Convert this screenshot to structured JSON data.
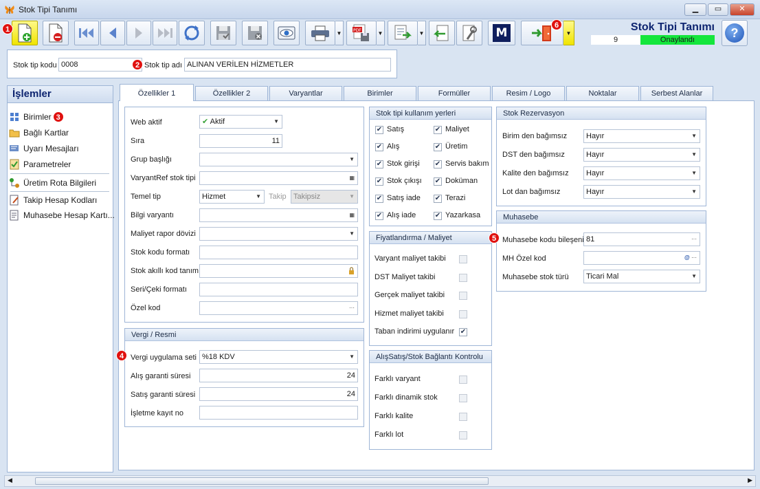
{
  "window": {
    "title": "Stok Tipi Tanımı",
    "min": "▁",
    "max": "▭",
    "close": "✕"
  },
  "header": {
    "title": "Stok Tipi Tanımı",
    "number": "9",
    "status": "Onaylandı",
    "status_color": "#14e63c"
  },
  "badges": [
    "1",
    "2",
    "3",
    "4",
    "5",
    "6"
  ],
  "toolbar": {
    "m_label": "M",
    "help_label": "?",
    "pdf_label": "PDF"
  },
  "top": {
    "code_label": "Stok tip kodu",
    "code_value": "0008",
    "name_label": "Stok tip adı",
    "name_value": "ALINAN VERİLEN HİZMETLER"
  },
  "sidebar": {
    "title": "İşlemler",
    "items": [
      "Birimler",
      "Bağlı Kartlar",
      "Uyarı Mesajları",
      "Parametreler",
      "Üretim Rota Bilgileri",
      "Takip Hesap Kodları",
      "Muhasebe Hesap Kartı..."
    ]
  },
  "tabs": [
    "Özellikler 1",
    "Özellikler 2",
    "Varyantlar",
    "Birimler",
    "Formüller",
    "Resim / Logo",
    "Noktalar",
    "Serbest Alanlar"
  ],
  "props": {
    "web_aktif": {
      "label": "Web aktif",
      "value": "Aktif"
    },
    "sira": {
      "label": "Sıra",
      "value": "11"
    },
    "grup": {
      "label": "Grup başlığı",
      "value": ""
    },
    "varyantref": {
      "label": "VaryantRef stok tipi",
      "value": ""
    },
    "temel_tip": {
      "label": "Temel tip",
      "value": "Hizmet",
      "takip_label": "Takip",
      "takip_value": "Takipsiz"
    },
    "bilgi_varyanti": {
      "label": "Bilgi varyantı",
      "value": ""
    },
    "maliyet_rapor": {
      "label": "Maliyet rapor dövizi",
      "value": ""
    },
    "stok_kodu_formati": {
      "label": "Stok kodu formatı",
      "value": ""
    },
    "akilli_kod": {
      "label": "Stok akıllı kod tanımı",
      "value": ""
    },
    "seri_ceki": {
      "label": "Seri/Çeki formatı",
      "value": ""
    },
    "ozel_kod": {
      "label": "Özel kod",
      "value": ""
    }
  },
  "vergi": {
    "title": "Vergi / Resmi",
    "uygulama": {
      "label": "Vergi uygulama seti",
      "value": "%18 KDV"
    },
    "alis_garanti": {
      "label": "Alış garanti süresi",
      "value": "24"
    },
    "satis_garanti": {
      "label": "Satış garanti süresi",
      "value": "24"
    },
    "isletme": {
      "label": "İşletme kayıt no",
      "value": ""
    }
  },
  "kullanim": {
    "title": "Stok tipi kullanım yerleri",
    "left": [
      "Satış",
      "Alış",
      "Stok girişi",
      "Stok çıkışı",
      "Satış iade",
      "Alış iade"
    ],
    "right": [
      "Maliyet",
      "Üretim",
      "Servis bakım",
      "Doküman",
      "Terazi",
      "Yazarkasa"
    ],
    "checked_mark": "✔"
  },
  "fiyat": {
    "title": "Fiyatlandırma / Maliyet",
    "items": [
      "Varyant maliyet takibi",
      "DST Maliyet takibi",
      "Gerçek maliyet takibi",
      "Hizmet maliyet takibi",
      "Taban indirimi uygulanır"
    ],
    "checked": [
      false,
      false,
      false,
      false,
      true
    ]
  },
  "alissatis": {
    "title": "AlışSatış/Stok Bağlantı Kontrolu",
    "items": [
      "Farklı varyant",
      "Farklı dinamik stok",
      "Farklı kalite",
      "Farklı lot"
    ]
  },
  "rezervasyon": {
    "title": "Stok Rezervasyon",
    "rows": [
      {
        "label": "Birim den bağımsız",
        "value": "Hayır"
      },
      {
        "label": "DST den bağımsız",
        "value": "Hayır"
      },
      {
        "label": "Kalite den bağımsız",
        "value": "Hayır"
      },
      {
        "label": "Lot dan bağımsız",
        "value": "Hayır"
      }
    ]
  },
  "muhasebe": {
    "title": "Muhasebe",
    "kod_bileseni": {
      "label": "Muhasebe kodu bileşeni",
      "value": "81"
    },
    "mh_ozel": {
      "label": "MH Özel kod",
      "value": ""
    },
    "stok_turu": {
      "label": "Muhasebe stok türü",
      "value": "Ticari Mal"
    }
  },
  "glyphs": {
    "dd": "▼",
    "ellipsis": "···",
    "at": "@"
  }
}
